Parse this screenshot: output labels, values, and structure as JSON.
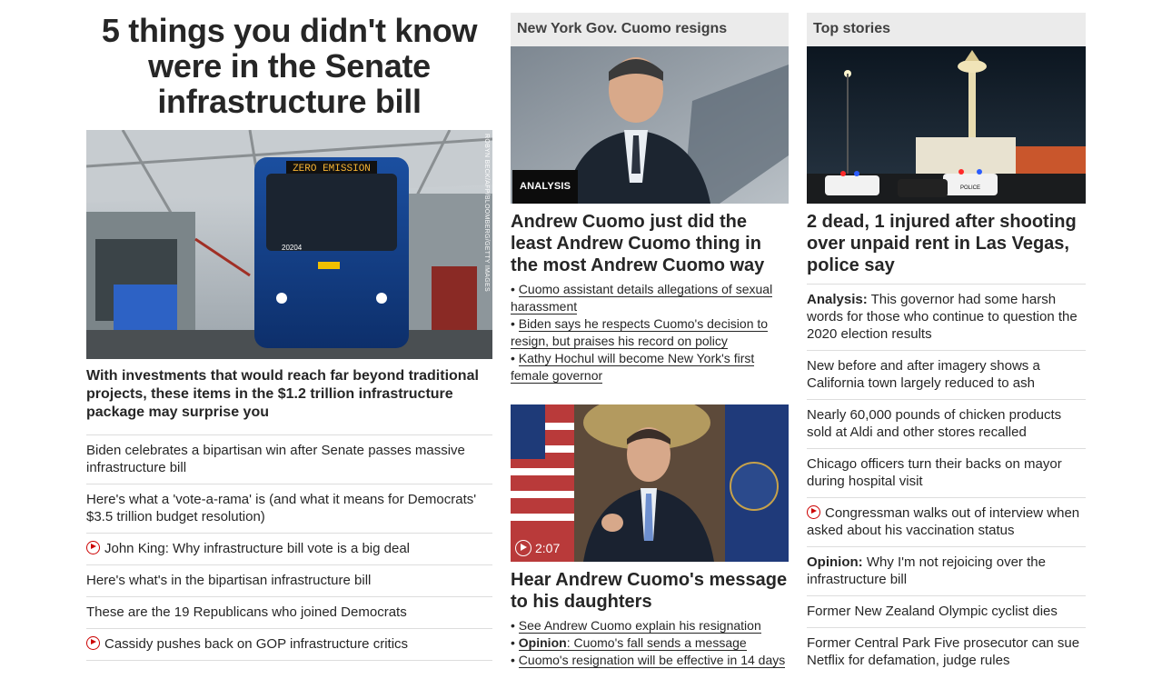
{
  "lead": {
    "headline": "5 things you didn't know were in the Senate infrastructure bill",
    "photo_credit": "ROBYN BECK/AFP/BLOOMBERG/GETTY IMAGES",
    "bus_sign": "ZERO EMISSION",
    "bus_number": "20204",
    "subhead": "With investments that would reach far beyond traditional projects, these items in the $1.2 trillion infrastructure package may surprise you",
    "related": [
      {
        "text": "Biden celebrates a bipartisan win after Senate passes massive infrastructure bill",
        "video": false
      },
      {
        "text": "Here's what a 'vote-a-rama' is (and what it means for Democrats' $3.5 trillion budget resolution)",
        "video": false
      },
      {
        "text": "John King: Why infrastructure bill vote is a big deal",
        "video": true
      },
      {
        "text": "Here's what's in the bipartisan infrastructure bill",
        "video": false
      },
      {
        "text": "These are the 19 Republicans who joined Democrats",
        "video": false
      },
      {
        "text": "Cassidy pushes back on GOP infrastructure critics",
        "video": true
      }
    ]
  },
  "cuomo": {
    "section_label": "New York Gov. Cuomo resigns",
    "badge": "ANALYSIS",
    "headline": "Andrew Cuomo just did the least Andrew Cuomo thing in the most Andrew Cuomo way",
    "bullets": [
      "Cuomo assistant details allegations of sexual harassment",
      "Biden says he respects Cuomo's decision to resign, but praises his record on policy",
      "Kathy Hochul will become New York's first female governor"
    ],
    "video_duration": "2:07",
    "video_headline": "Hear Andrew Cuomo's message to his daughters",
    "video_bullets": [
      {
        "label": "",
        "text": "See Andrew Cuomo explain his resignation"
      },
      {
        "label": "Opinion",
        "text": ": Cuomo's fall sends a message"
      },
      {
        "label": "",
        "text": "Cuomo's resignation will be effective in 14 days"
      }
    ]
  },
  "top": {
    "section_label": "Top stories",
    "headline": "2 dead, 1 injured after shooting over unpaid rent in Las Vegas, police say",
    "police_text": "POLICE",
    "items": [
      {
        "label": "Analysis:",
        "text": " This governor had some harsh words for those who continue to question the 2020 election results",
        "video": false
      },
      {
        "label": "",
        "text": "New before and after imagery shows a California town largely reduced to ash",
        "video": false
      },
      {
        "label": "",
        "text": "Nearly 60,000 pounds of chicken products sold at Aldi and other stores recalled",
        "video": false
      },
      {
        "label": "",
        "text": "Chicago officers turn their backs on mayor during hospital visit",
        "video": false
      },
      {
        "label": "",
        "text": "Congressman walks out of interview when asked about his vaccination status",
        "video": true
      },
      {
        "label": "Opinion:",
        "text": " Why I'm not rejoicing over the infrastructure bill",
        "video": false
      },
      {
        "label": "",
        "text": "Former New Zealand Olympic cyclist dies",
        "video": false
      },
      {
        "label": "",
        "text": "Former Central Park Five prosecutor can sue Netflix for defamation, judge rules",
        "video": false
      }
    ]
  },
  "colors": {
    "accent_red": "#cc0000",
    "label_bg": "#ebebeb",
    "divider": "#dddddd"
  }
}
